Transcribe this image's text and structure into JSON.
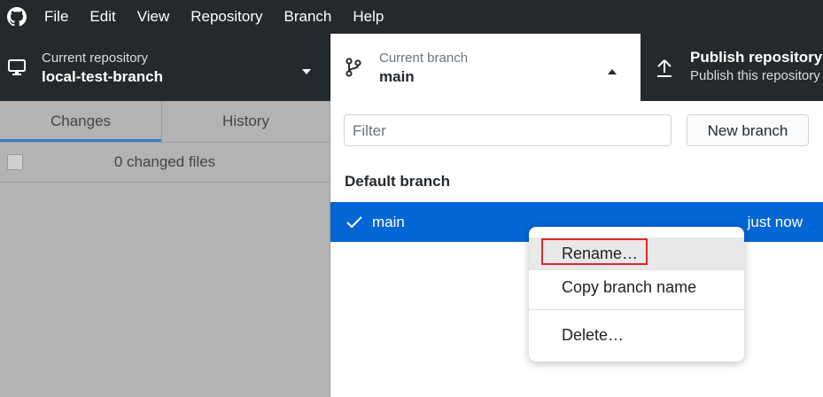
{
  "menu": {
    "items": [
      "File",
      "Edit",
      "View",
      "Repository",
      "Branch",
      "Help"
    ]
  },
  "toolbar": {
    "repository": {
      "label": "Current repository",
      "value": "local-test-branch"
    },
    "branch": {
      "label": "Current branch",
      "value": "main"
    },
    "publish": {
      "label": "Publish repository",
      "description": "Publish this repository to GitHub"
    }
  },
  "left_panel": {
    "tabs": {
      "changes": "Changes",
      "history": "History"
    },
    "changed_files": "0 changed files"
  },
  "branch_panel": {
    "filter_placeholder": "Filter",
    "new_branch_label": "New branch",
    "section_title": "Default branch",
    "branches": [
      {
        "name": "main",
        "time": "just now",
        "selected": true
      }
    ]
  },
  "context_menu": {
    "items": [
      "Rename…",
      "Copy branch name",
      "Delete…"
    ]
  },
  "colors": {
    "toolbar_bg": "#24292e",
    "accent": "#0366d6",
    "highlight_box": "#e0262b"
  }
}
